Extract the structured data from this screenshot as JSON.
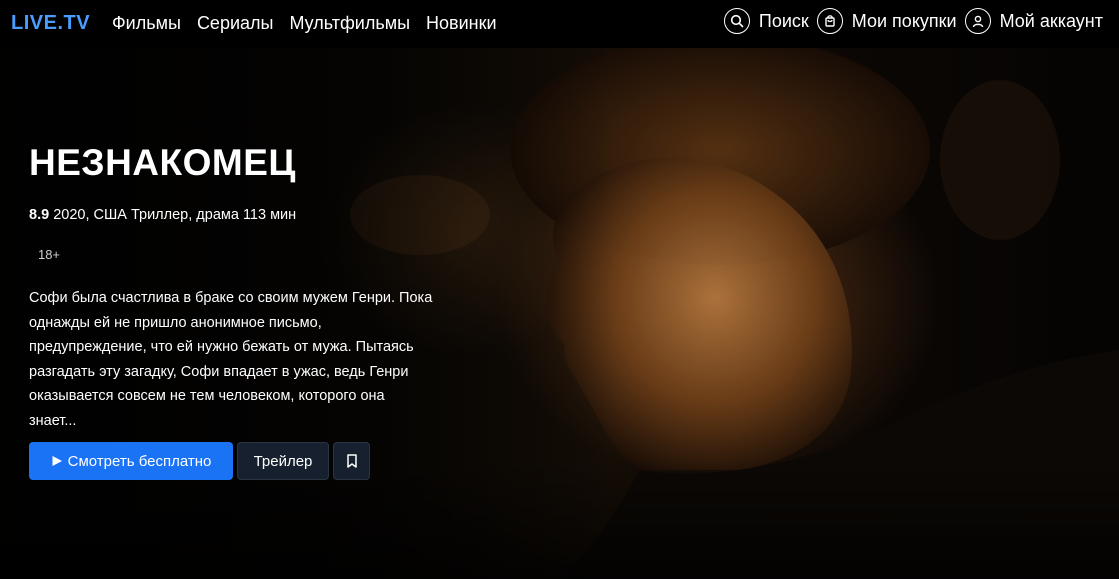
{
  "brand": {
    "logo": "LIVE.TV",
    "accent": "#4a9dff"
  },
  "nav": {
    "links": [
      "Фильмы",
      "Сериалы",
      "Мультфильмы",
      "Новинки"
    ],
    "actions": [
      {
        "icon": "search-icon",
        "label": "Поиск"
      },
      {
        "icon": "bag-icon",
        "label": "Мои покупки"
      },
      {
        "icon": "user-icon",
        "label": "Мой аккаунт"
      }
    ]
  },
  "movie": {
    "title": "НЕЗНАКОМЕЦ",
    "rating": "8.9",
    "details": "2020, США Триллер, драма 113 мин",
    "age": "18+",
    "description": "Софи была счастлива в браке со своим мужем Генри. Пока однажды ей не пришло анонимное письмо, предупреждение, что ей нужно бежать от мужа. Пытаясь разгадать эту загадку, Софи впадает в ужас, ведь Генри оказывается совсем не тем человеком, которого она знает..."
  },
  "buttons": {
    "watch": "Смотреть бесплатно",
    "trailer": "Трейлер",
    "bookmark_icon": "bookmark-icon",
    "primary_color": "#1a73f5"
  }
}
